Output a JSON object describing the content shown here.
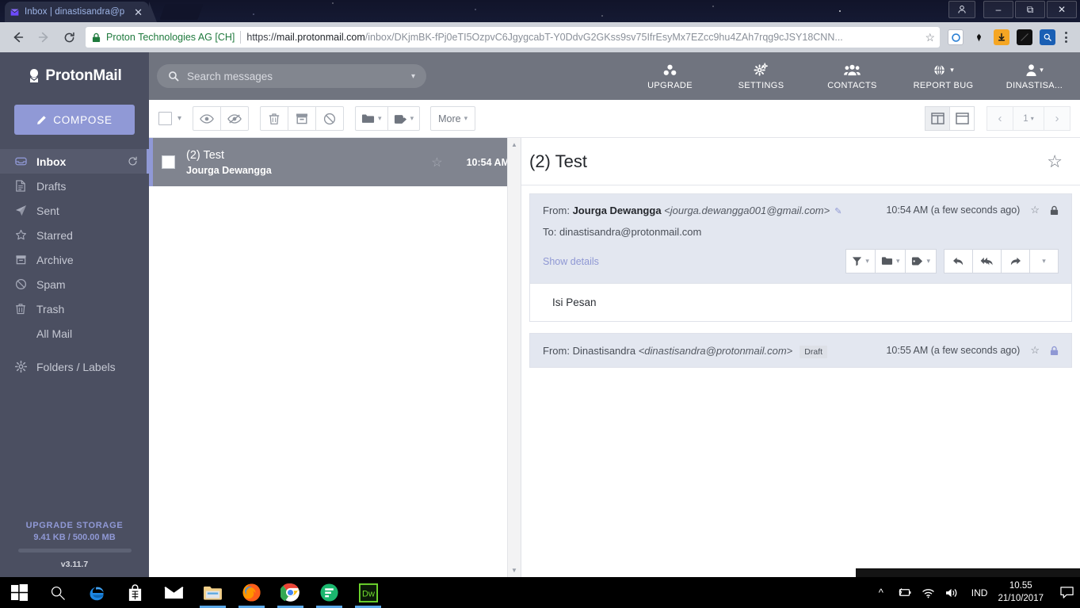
{
  "browser": {
    "tab": {
      "title": "Inbox | dinastisandra@p",
      "favicon_icon": "protonmail-favicon",
      "close_icon": "close-icon"
    },
    "window_controls": [
      {
        "name": "profile-button",
        "label": "person-icon"
      },
      {
        "name": "minimize-button",
        "label": "minimize-icon"
      },
      {
        "name": "maximize-button",
        "label": "restore-icon"
      },
      {
        "name": "close-button",
        "label": "close-icon"
      }
    ],
    "back_icon": "back-arrow-icon",
    "forward_icon": "forward-arrow-icon",
    "reload_icon": "reload-icon",
    "omnibox": {
      "lock_icon": "lock-icon",
      "site_identity": "Proton Technologies AG [CH]",
      "url_scheme": "https://",
      "url_host": "mail.protonmail.com",
      "url_path": "/inbox/DKjmBK-fPj0eTI5OzpvC6JgygcabT-Y0DdvG2GKss9sv75IfrEsyMx7EZcc9hu4ZAh7rqg9cJSY18CNN...",
      "bookmark_icon": "star-icon"
    },
    "extensions": [
      "extension-blue-circle-icon",
      "extension-dark-icon",
      "download-icon",
      "extension-black-icon",
      "search-extension-icon"
    ],
    "menu_icon": "kebab-menu-icon"
  },
  "sidebar": {
    "brand": "ProtonMail",
    "brand_icon": "protonmail-logo",
    "compose": {
      "label": "COMPOSE",
      "icon": "pencil-icon"
    },
    "items": [
      {
        "label": "Inbox",
        "icon": "inbox-icon",
        "active": true,
        "refresh_icon": "refresh-icon"
      },
      {
        "label": "Drafts",
        "icon": "drafts-icon",
        "active": false
      },
      {
        "label": "Sent",
        "icon": "sent-icon",
        "active": false
      },
      {
        "label": "Starred",
        "icon": "star-icon",
        "active": false
      },
      {
        "label": "Archive",
        "icon": "archive-icon",
        "active": false
      },
      {
        "label": "Spam",
        "icon": "spam-icon",
        "active": false
      },
      {
        "label": "Trash",
        "icon": "trash-icon",
        "active": false
      },
      {
        "label": "All Mail",
        "icon": "",
        "active": false
      },
      {
        "label": "Folders / Labels",
        "icon": "gear-icon",
        "active": false
      }
    ],
    "storage": {
      "upgrade_label": "UPGRADE STORAGE",
      "usage": "9.41 KB / 500.00 MB",
      "version": "v3.11.7"
    }
  },
  "topbar": {
    "search": {
      "placeholder": "Search messages",
      "icon": "search-icon",
      "chevron": "chevron-down-icon"
    },
    "nav": [
      {
        "label": "UPGRADE",
        "icon": "upgrade-icon"
      },
      {
        "label": "SETTINGS",
        "icon": "gear-icon"
      },
      {
        "label": "CONTACTS",
        "icon": "contacts-icon"
      },
      {
        "label": "REPORT BUG",
        "icon": "bug-report-icon",
        "chevron": true
      },
      {
        "label": "DINASTISA...",
        "icon": "user-icon",
        "chevron": true
      }
    ]
  },
  "toolbar": {
    "select_all_checkbox": "select-all-checkbox",
    "select_all_chevron": "chevron-down-icon",
    "groups": [
      {
        "buttons": [
          {
            "icon": "mark-read-icon"
          },
          {
            "icon": "mark-unread-icon"
          }
        ]
      },
      {
        "buttons": [
          {
            "icon": "trash-icon"
          },
          {
            "icon": "archive-icon"
          },
          {
            "icon": "spam-icon"
          }
        ]
      },
      {
        "buttons": [
          {
            "icon": "folder-icon",
            "chevron": true
          },
          {
            "icon": "label-icon",
            "chevron": true
          }
        ]
      }
    ],
    "more": {
      "label": "More",
      "chevron": "chevron-down-icon"
    },
    "view_column_icon": "column-view-icon",
    "view_row_icon": "row-view-icon",
    "prev_icon": "chevron-left-icon",
    "page_number": "1",
    "page_chevron": "chevron-down-icon",
    "next_icon": "chevron-right-icon"
  },
  "mail_list": {
    "rows": [
      {
        "subject": "(2) Test",
        "sender": "Jourga Dewangga",
        "time": "10:54 AM",
        "star_icon": "star-icon",
        "checkbox": "row-checkbox",
        "selected": true
      }
    ]
  },
  "reading_pane": {
    "subject": "(2) Test",
    "star_icon": "star-icon",
    "messages": [
      {
        "from_label": "From:",
        "from_name": "Jourga Dewangga",
        "from_email": "<jourga.dewangga001@gmail.com>",
        "edit_icon": "pencil-icon",
        "to_label": "To:",
        "to_email": "dinastisandra@protonmail.com",
        "time": "10:54 AM (a few seconds ago)",
        "star_icon": "star-icon",
        "lock_icon": "lock-icon",
        "show_details": "Show details",
        "actions": [
          {
            "icon": "filter-icon",
            "chevron": true
          },
          {
            "icon": "folder-icon",
            "chevron": true
          },
          {
            "icon": "label-icon",
            "chevron": true
          },
          {
            "icon": "reply-icon"
          },
          {
            "icon": "reply-all-icon"
          },
          {
            "icon": "forward-icon"
          },
          {
            "icon": "chevron-down-icon"
          }
        ],
        "body": "Isi Pesan",
        "expanded": true
      },
      {
        "from_label": "From:",
        "from_name": "Dinastisandra",
        "from_email": "<dinastisandra@protonmail.com>",
        "badge": "Draft",
        "time": "10:55 AM (a few seconds ago)",
        "star_icon": "star-icon",
        "lock_icon": "lock-icon",
        "expanded": false
      }
    ]
  },
  "taskbar": {
    "apps": [
      {
        "name": "start-button",
        "icon": "windows-logo-icon"
      },
      {
        "name": "search-taskbar",
        "icon": "search-icon"
      },
      {
        "name": "edge-taskbar",
        "icon": "edge-icon"
      },
      {
        "name": "store-taskbar",
        "icon": "store-icon"
      },
      {
        "name": "mail-taskbar",
        "icon": "mail-icon"
      },
      {
        "name": "explorer-taskbar",
        "icon": "folder-icon"
      },
      {
        "name": "firefox-taskbar",
        "icon": "firefox-icon"
      },
      {
        "name": "chrome-taskbar",
        "icon": "chrome-icon"
      },
      {
        "name": "app-green-taskbar",
        "icon": "green-app-icon"
      },
      {
        "name": "dreamweaver-taskbar",
        "icon": "dreamweaver-icon"
      }
    ],
    "tray": {
      "overflow_icon": "chevron-up-icon",
      "battery_icon": "battery-icon",
      "wifi_icon": "wifi-icon",
      "volume_icon": "volume-icon",
      "language": "IND",
      "time": "10.55",
      "date": "21/10/2017",
      "notification_icon": "notification-icon"
    }
  },
  "colors": {
    "sidebar_bg": "#4b4f61",
    "accent_purple": "#9099d6",
    "topbar_bg": "#70747f",
    "selected_row_bg": "#80848f",
    "msg_head_bg": "#e3e7f0"
  }
}
